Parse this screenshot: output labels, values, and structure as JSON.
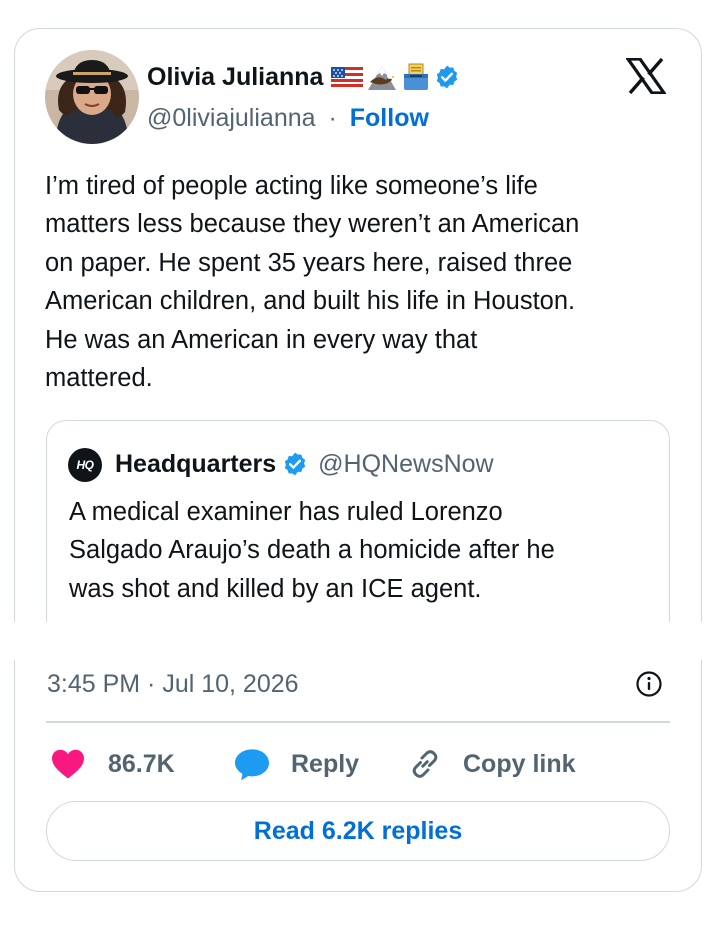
{
  "author": {
    "display_name": "Olivia Julianna",
    "name_emojis": [
      "us-flag-emoji",
      "eagle-mountain-emoji",
      "ballot-box-emoji"
    ],
    "verified": true,
    "handle": "@0liviajulianna",
    "separator": "·",
    "follow_label": "Follow"
  },
  "platform_logo": "x-logo-icon",
  "tweet": {
    "lines": [
      "I’m tired of people acting like someone’s life",
      "matters less because they weren’t an American",
      "on paper. He spent 35 years here, raised three",
      "American children, and built his life in Houston.",
      "He was an American in every way that",
      "mattered."
    ]
  },
  "quote": {
    "avatar_text": "HQ",
    "name": "Headquarters",
    "verified": true,
    "handle": "@HQNewsNow",
    "lines": [
      "A medical examiner has ruled Lorenzo",
      "Salgado Araujo’s death a homicide after he",
      "was shot and killed by an ICE agent."
    ]
  },
  "timestamp": "3:45 PM · Jul 10, 2026",
  "actions": {
    "like_count": "86.7K",
    "reply_label": "Reply",
    "copy_link_label": "Copy link"
  },
  "read_replies_label": "Read 6.2K replies",
  "colors": {
    "accent_blue": "#006fd6",
    "verified_blue": "#1d9bf0",
    "like_pink": "#f91880",
    "secondary_text": "#536471",
    "border": "#cfd9de"
  }
}
